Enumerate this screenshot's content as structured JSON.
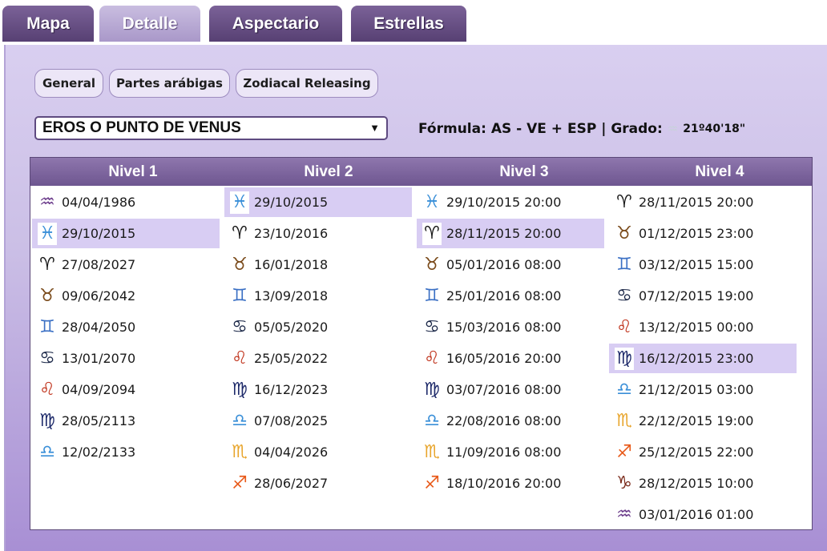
{
  "tabs": [
    {
      "label": "Mapa",
      "active": false
    },
    {
      "label": "Detalle",
      "active": true
    },
    {
      "label": "Aspectario",
      "active": false
    },
    {
      "label": "Estrellas",
      "active": false
    }
  ],
  "subtabs": [
    "General",
    "Partes arábigas",
    "Zodiacal Releasing"
  ],
  "select": {
    "value": "EROS O PUNTO DE VENUS"
  },
  "formula": {
    "label": "Fórmula: AS - VE + ESP | Grado:",
    "degree": "21º40'18\""
  },
  "colors": {
    "aries": "#1a1a1a",
    "taurus": "#7a4a1a",
    "gemini": "#3a6fc4",
    "cancer": "#1e2a4a",
    "leo": "#c0341d",
    "virgo": "#1e2a6a",
    "libra": "#3a8fd8",
    "scorpio": "#e8a52c",
    "sagittarius": "#e85a1a",
    "capricorn": "#7a2a1a",
    "aquarius": "#6a3a8a",
    "pisces": "#3a8fd8",
    "selected_row": "#d8cdf3"
  },
  "table": {
    "headers": [
      "Nivel 1",
      "Nivel 2",
      "Nivel 3",
      "Nivel 4"
    ],
    "columns": [
      [
        {
          "sign": "aquarius",
          "text": "04/04/1986"
        },
        {
          "sign": "pisces",
          "text": "29/10/2015",
          "selected": true
        },
        {
          "sign": "aries",
          "text": "27/08/2027"
        },
        {
          "sign": "taurus",
          "text": "09/06/2042"
        },
        {
          "sign": "gemini",
          "text": "28/04/2050"
        },
        {
          "sign": "cancer",
          "text": "13/01/2070"
        },
        {
          "sign": "leo",
          "text": "04/09/2094"
        },
        {
          "sign": "virgo",
          "text": "28/05/2113"
        },
        {
          "sign": "libra",
          "text": "12/02/2133"
        }
      ],
      [
        {
          "sign": "pisces",
          "text": "29/10/2015",
          "selected": true
        },
        {
          "sign": "aries",
          "text": "23/10/2016"
        },
        {
          "sign": "taurus",
          "text": "16/01/2018"
        },
        {
          "sign": "gemini",
          "text": "13/09/2018"
        },
        {
          "sign": "cancer",
          "text": "05/05/2020"
        },
        {
          "sign": "leo",
          "text": "25/05/2022"
        },
        {
          "sign": "virgo",
          "text": "16/12/2023"
        },
        {
          "sign": "libra",
          "text": "07/08/2025"
        },
        {
          "sign": "scorpio",
          "text": "04/04/2026"
        },
        {
          "sign": "sagittarius",
          "text": "28/06/2027"
        }
      ],
      [
        {
          "sign": "pisces",
          "text": "29/10/2015 20:00"
        },
        {
          "sign": "aries",
          "text": "28/11/2015 20:00",
          "selected": true
        },
        {
          "sign": "taurus",
          "text": "05/01/2016 08:00"
        },
        {
          "sign": "gemini",
          "text": "25/01/2016 08:00"
        },
        {
          "sign": "cancer",
          "text": "15/03/2016 08:00"
        },
        {
          "sign": "leo",
          "text": "16/05/2016 20:00"
        },
        {
          "sign": "virgo",
          "text": "03/07/2016 08:00"
        },
        {
          "sign": "libra",
          "text": "22/08/2016 08:00"
        },
        {
          "sign": "scorpio",
          "text": "11/09/2016 08:00"
        },
        {
          "sign": "sagittarius",
          "text": "18/10/2016 20:00"
        }
      ],
      [
        {
          "sign": "aries",
          "text": "28/11/2015 20:00"
        },
        {
          "sign": "taurus",
          "text": "01/12/2015 23:00"
        },
        {
          "sign": "gemini",
          "text": "03/12/2015 15:00"
        },
        {
          "sign": "cancer",
          "text": "07/12/2015 19:00"
        },
        {
          "sign": "leo",
          "text": "13/12/2015 00:00"
        },
        {
          "sign": "virgo",
          "text": "16/12/2015 23:00",
          "selected": true
        },
        {
          "sign": "libra",
          "text": "21/12/2015 03:00"
        },
        {
          "sign": "scorpio",
          "text": "22/12/2015 19:00"
        },
        {
          "sign": "sagittarius",
          "text": "25/12/2015 22:00"
        },
        {
          "sign": "capricorn",
          "text": "28/12/2015 10:00"
        },
        {
          "sign": "aquarius",
          "text": "03/01/2016 01:00"
        }
      ]
    ]
  }
}
